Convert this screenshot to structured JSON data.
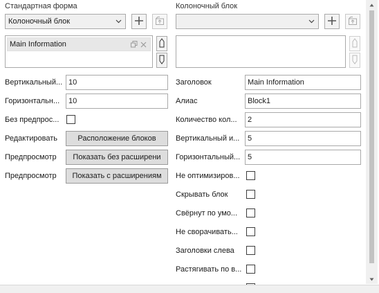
{
  "left": {
    "section_title": "Стандартная форма",
    "combo_value": "Колоночный блок",
    "list_items": [
      "Main Information"
    ],
    "properties": [
      {
        "label": "Вертикальный...",
        "value": "10"
      },
      {
        "label": "Горизонтальн...",
        "value": "10"
      }
    ],
    "no_preview_label": "Без предпрос...",
    "edit_label": "Редактировать",
    "edit_button": "Расположение блоков",
    "preview1_label": "Предпросмотр",
    "preview1_button": "Показать без расширени",
    "preview2_label": "Предпросмотр",
    "preview2_button": "Показать с расширениям"
  },
  "right": {
    "section_title": "Колоночный блок",
    "combo_value": "",
    "fields": [
      {
        "label": "Заголовок",
        "value": "Main Information"
      },
      {
        "label": "Алиас",
        "value": "Block1"
      },
      {
        "label": "Количество кол...",
        "value": "2"
      },
      {
        "label": "Вертикальный и...",
        "value": "5"
      },
      {
        "label": "Горизонтальный...",
        "value": "5"
      }
    ],
    "checkboxes": [
      {
        "label": "Не оптимизиров...",
        "checked": false
      },
      {
        "label": "Скрывать блок",
        "checked": false
      },
      {
        "label": "Свёрнут по умо...",
        "checked": false
      },
      {
        "label": "Не сворачивать...",
        "checked": false
      },
      {
        "label": "Заголовки слева",
        "checked": false
      },
      {
        "label": "Растягивать по в...",
        "checked": false
      }
    ]
  },
  "icons": {
    "add": "plus-icon",
    "import": "import-icon",
    "copy": "copy-icon",
    "remove": "close-icon",
    "up": "move-up-icon",
    "down": "move-down-icon",
    "dropdown": "chevron-down-icon"
  }
}
